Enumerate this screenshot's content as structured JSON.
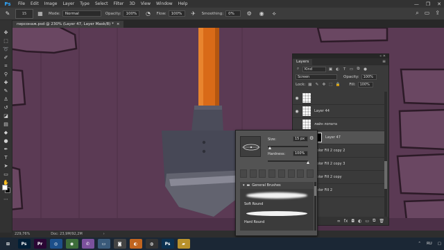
{
  "app": {
    "logo": "Ps"
  },
  "menu": [
    "File",
    "Edit",
    "Image",
    "Layer",
    "Type",
    "Select",
    "Filter",
    "3D",
    "View",
    "Window",
    "Help"
  ],
  "window_controls": {
    "minimize": "—",
    "maximize": "❐",
    "close": "✕"
  },
  "options": {
    "brush_size": "15",
    "mode_label": "Mode:",
    "mode_value": "Normal",
    "opacity_label": "Opacity:",
    "opacity_value": "100%",
    "flow_label": "Flow:",
    "flow_value": "100%",
    "smoothing_label": "Smoothing:",
    "smoothing_value": "0%"
  },
  "document": {
    "tab_label": "персонаж.psd @ 230% (Layer 47, Layer Mask/8) *",
    "close": "×"
  },
  "status": {
    "zoom": "229,76%",
    "doc": "Doc: 23,9M/92,2M",
    "arrow": "›"
  },
  "layers_panel": {
    "tab": "Layers",
    "top_controls": "«  ✕",
    "kind_label": "Kind",
    "blend_mode": "Screen",
    "opacity_label": "Opacity:",
    "opacity_value": "100%",
    "lock_label": "Lock:",
    "fill_label": "Fill:",
    "fill_value": "100%",
    "layers": [
      {
        "name": "",
        "visible": true,
        "thumb": "checker",
        "selected": false
      },
      {
        "name": "Layer 44",
        "visible": true,
        "thumb": "checker",
        "selected": false
      },
      {
        "name": "лайн лопата",
        "visible": false,
        "thumb": "checker",
        "selected": false
      },
      {
        "name": "Layer 47",
        "visible": true,
        "thumb": "checker-mask",
        "selected": true
      },
      {
        "name": "Color Fill 2 copy 2",
        "visible": false,
        "thumb": "black",
        "selected": false
      },
      {
        "name": "Color Fill 2 copy 3",
        "visible": false,
        "thumb": "black",
        "selected": false
      },
      {
        "name": "Color Fill 2 copy",
        "visible": false,
        "thumb": "black",
        "selected": false
      },
      {
        "name": "Color Fill 2",
        "visible": false,
        "thumb": "black",
        "selected": false
      }
    ],
    "bottom_icons": [
      "∞",
      "fx",
      "◘",
      "◐",
      "▭",
      "⧉",
      "🗑"
    ]
  },
  "brush_popup": {
    "size_label": "Size:",
    "size_value": "15 px",
    "hardness_label": "Hardness:",
    "hardness_value": "100%",
    "hardness_level": 1.0,
    "size_level": 0.06,
    "folder_name": "General Brushes",
    "brushes": [
      {
        "name": "Soft Round",
        "hard": false
      },
      {
        "name": "Hard Round",
        "hard": true
      }
    ]
  },
  "taskbar": {
    "icons": [
      {
        "name": "windows-start-icon",
        "glyph": "⊞",
        "color": "#1b2735"
      },
      {
        "name": "photoshop-taskbar-icon",
        "glyph": "Ps",
        "color": "#001e36"
      },
      {
        "name": "premiere-taskbar-icon",
        "glyph": "Pr",
        "color": "#2a0634"
      },
      {
        "name": "cinema4d-taskbar-icon",
        "glyph": "◎",
        "color": "#1c4f8a"
      },
      {
        "name": "chrome-taskbar-icon",
        "glyph": "◉",
        "color": "#3d6d3a"
      },
      {
        "name": "viber-taskbar-icon",
        "glyph": "✆",
        "color": "#7b519d"
      },
      {
        "name": "monitor-taskbar-icon",
        "glyph": "▭",
        "color": "#3a5a7a"
      },
      {
        "name": "camera-taskbar-icon",
        "glyph": "◙",
        "color": "#444"
      },
      {
        "name": "blender-taskbar-icon",
        "glyph": "◐",
        "color": "#c0641f"
      },
      {
        "name": "obs-taskbar-icon",
        "glyph": "◍",
        "color": "#333"
      },
      {
        "name": "photoshop2-taskbar-icon",
        "glyph": "Ps",
        "color": "#0b3150"
      },
      {
        "name": "folder-taskbar-icon",
        "glyph": "▰",
        "color": "#b8912b"
      }
    ],
    "tray_lang": "RU"
  },
  "colors": {
    "canvas": "#5a3a53",
    "accent": "#31a8ff",
    "handle": "#d96a18",
    "shovel": "#4a4b57"
  }
}
